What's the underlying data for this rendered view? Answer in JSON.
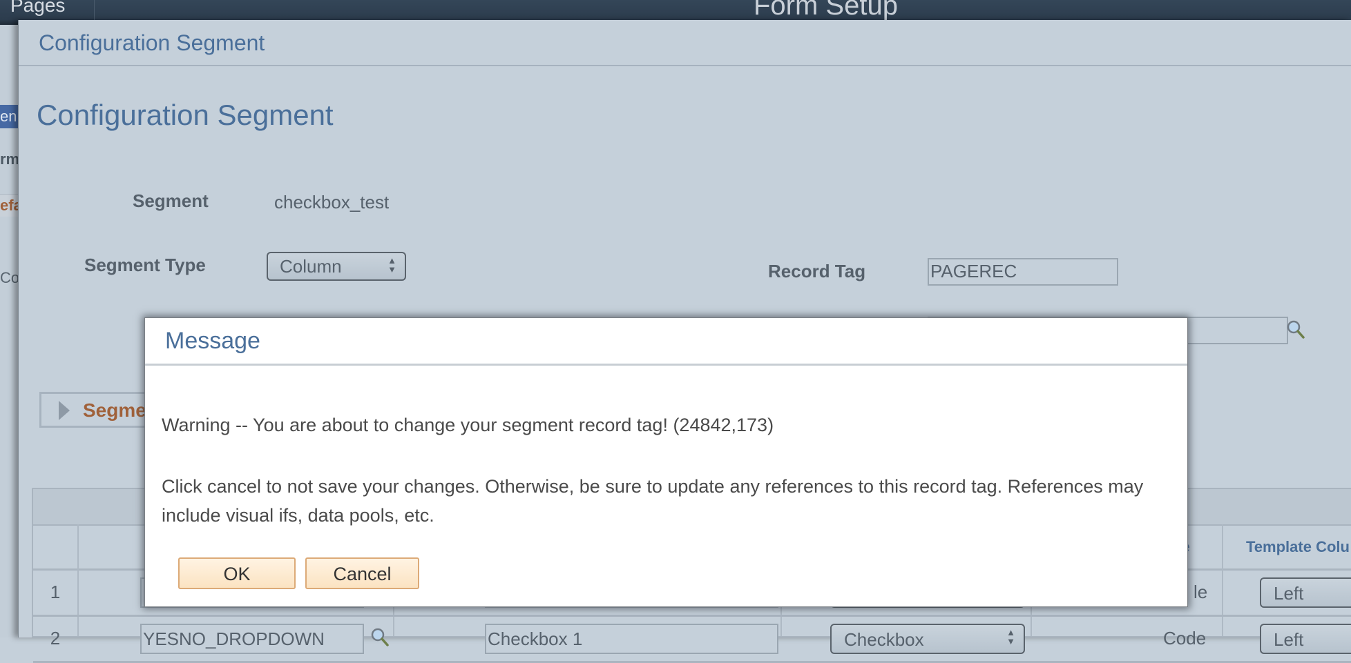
{
  "app_bar": {
    "left_menu": "Pages",
    "title": "Form Setup"
  },
  "background_partial": {
    "nav_item_text": "en",
    "label_1": "rm",
    "label_2": "efa",
    "label_3": "Co"
  },
  "config_window": {
    "header_title": "Configuration Segment",
    "page_title": "Configuration Segment",
    "fields": {
      "segment_label": "Segment",
      "segment_value": "checkbox_test",
      "segment_type_label": "Segment Type",
      "segment_type_value": "Column",
      "record_tag_label": "Record Tag",
      "record_tag_value": "PAGEREC",
      "lookup_field_value": ""
    },
    "collapsible_section_label": "Segme",
    "grid": {
      "column_headers": [
        "",
        "",
        "",
        "",
        "pe",
        "Template Colu"
      ],
      "rows": [
        {
          "num": "1",
          "type_suffix": "le",
          "template_column": "Left"
        },
        {
          "num": "2",
          "field": "YESNO_DROPDOWN",
          "label": "Checkbox 1",
          "type": "Checkbox",
          "type_suffix": "Code",
          "template_column": "Left"
        }
      ]
    }
  },
  "message_dialog": {
    "title": "Message",
    "warning_text": "Warning -- You are about to change your segment record tag! (24842,173)",
    "body_text": "Click cancel to not save your changes. Otherwise, be sure to update any references to this record tag. References may include visual ifs, data pools, etc.",
    "ok_label": "OK",
    "cancel_label": "Cancel"
  },
  "colors": {
    "accent_blue": "#4a6f9a",
    "section_orange": "#a0613a",
    "button_bg": "#fbe3c2",
    "button_border": "#dcaa77",
    "app_bar": "#2c3c4d"
  }
}
